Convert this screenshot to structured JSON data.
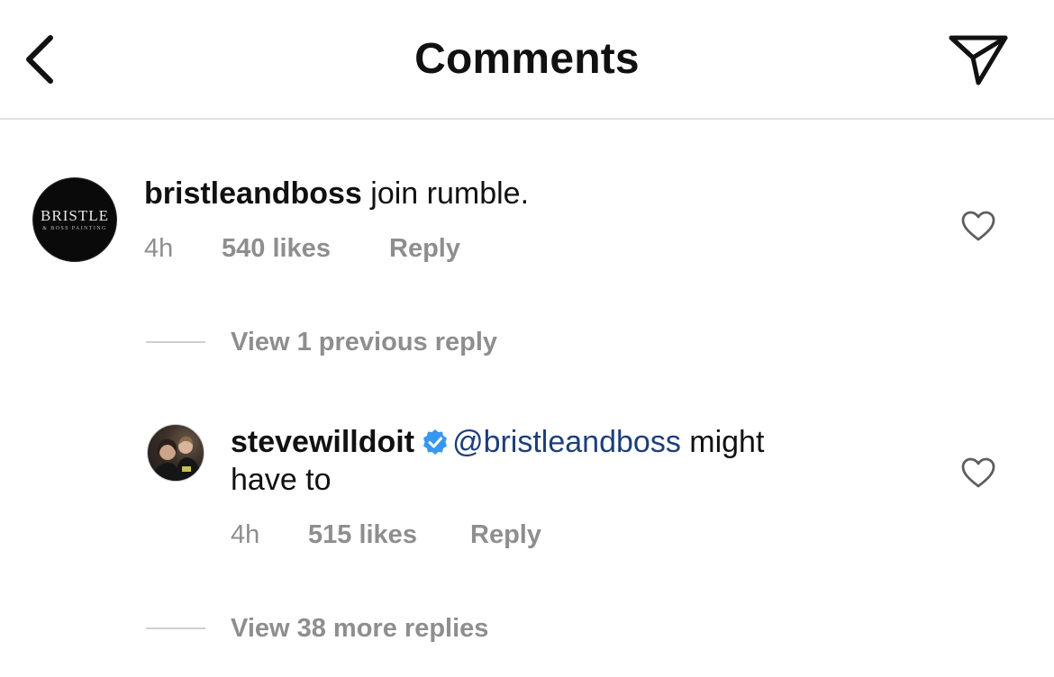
{
  "header": {
    "title": "Comments",
    "back_icon": "chevron-left-icon",
    "share_icon": "paper-plane-icon"
  },
  "comment": {
    "avatar_text": "BRISTLE",
    "avatar_subtext": "& BOSS PAINTING",
    "username": "bristleandboss",
    "text": " join rumble.",
    "time": "4h",
    "likes": "540 likes",
    "reply_label": "Reply"
  },
  "view_previous": "View 1 previous reply",
  "reply": {
    "username": "stevewilldoit",
    "verified": true,
    "mention": "@bristleandboss",
    "text_line1_rest": " might",
    "text_line2": "have to",
    "time": "4h",
    "likes": "515 likes",
    "reply_label": "Reply"
  },
  "view_more": "View 38 more replies",
  "colors": {
    "meta_gray": "#8e8e8e",
    "mention_blue": "#1d3f7a",
    "verified_blue": "#3897f0"
  }
}
